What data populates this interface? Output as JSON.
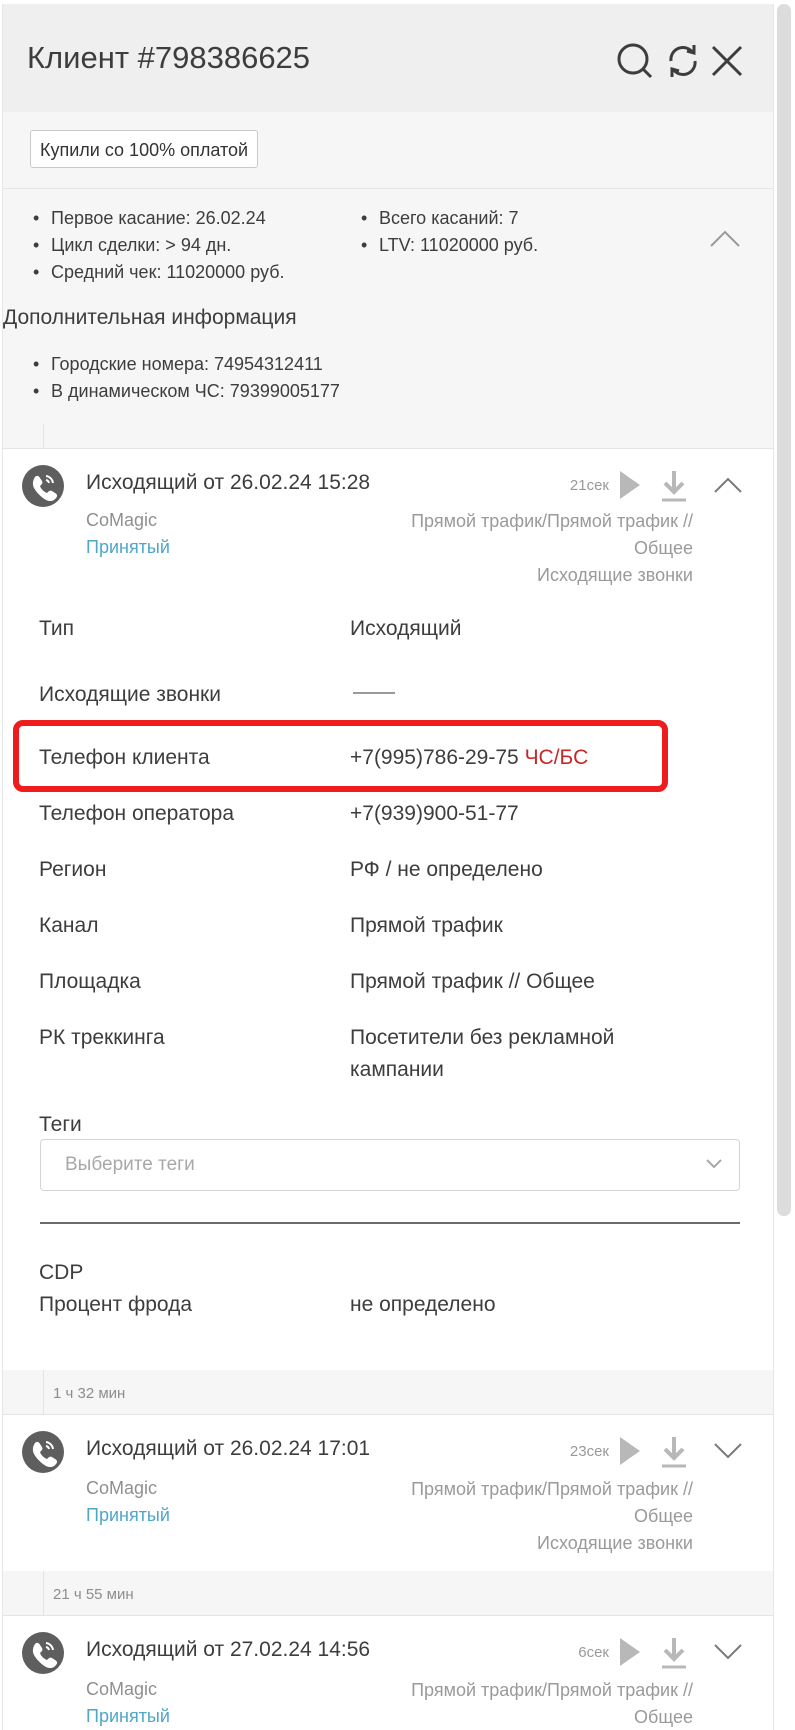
{
  "header": {
    "title": "Клиент #798386625"
  },
  "tag": "Купили со 100% оплатой",
  "summary": {
    "left": [
      "Первое касание: 26.02.24",
      "Цикл сделки: > 94 дн.",
      "Средний чек: 11020000 руб."
    ],
    "right": [
      "Всего касаний: 7",
      "LTV: 11020000 руб."
    ]
  },
  "additional": {
    "heading": "Дополнительная информация",
    "items": [
      "Городские номера: 74954312411",
      "В динамическом ЧС: 79399005177"
    ]
  },
  "calls": [
    {
      "title": "Исходящий от 26.02.24 15:28",
      "duration": "21сек",
      "provider": "CoMagic",
      "status": "Принятый",
      "source": [
        "Прямой трафик/Прямой трафик //",
        "Общее",
        "Исходящие звонки"
      ]
    },
    {
      "title": "Исходящий от 26.02.24 17:01",
      "duration": "23сек",
      "provider": "CoMagic",
      "status": "Принятый",
      "source": [
        "Прямой трафик/Прямой трафик //",
        "Общее",
        "Исходящие звонки"
      ]
    },
    {
      "title": "Исходящий от 27.02.24 14:56",
      "duration": "6сек",
      "provider": "CoMagic",
      "status": "Принятый",
      "source": [
        "Прямой трафик/Прямой трафик //",
        "Общее"
      ]
    }
  ],
  "details": {
    "type_label": "Тип",
    "type_value": "Исходящий",
    "outgoing_label": "Исходящие звонки",
    "client_phone_label": "Телефон клиента",
    "client_phone_value": "+7(995)786-29-75",
    "client_phone_flag": "ЧС/БС",
    "operator_phone_label": "Телефон оператора",
    "operator_phone_value": "+7(939)900-51-77",
    "region_label": "Регион",
    "region_value": "РФ / не определено",
    "channel_label": "Канал",
    "channel_value": "Прямой трафик",
    "site_label": "Площадка",
    "site_value": "Прямой трафик // Общее",
    "campaign_label": "РК треккинга",
    "campaign_value_1": "Посетители без рекламной",
    "campaign_value_2": "кампании",
    "tags_label": "Теги",
    "tags_placeholder": "Выберите теги",
    "cdp_label": "CDP",
    "fraud_label": "Процент фрода",
    "fraud_value": "не определено"
  },
  "gaps": [
    "1 ч 32 мин",
    "21 ч 55 мин"
  ]
}
